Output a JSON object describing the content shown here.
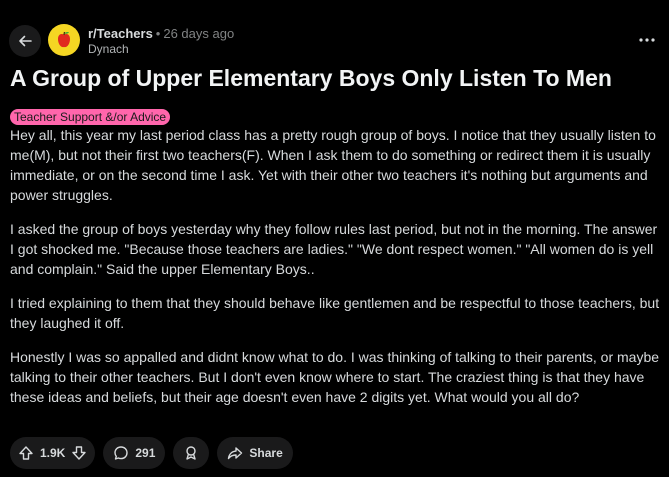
{
  "header": {
    "subreddit": "r/Teachers",
    "separator": "•",
    "time_ago": "26 days ago",
    "author": "Dynach"
  },
  "post": {
    "title": "A Group of Upper Elementary Boys Only Listen To Men",
    "flair": "Teacher Support &/or Advice",
    "paragraphs": [
      "Hey all, this year my last period class has a pretty rough group of boys. I notice that they usually listen to me(M), but not their first two teachers(F). When I ask them to do something or redirect them it is usually immediate, or on the second time I ask. Yet with their other two teachers it's nothing but arguments and power struggles.",
      "I asked the group of boys yesterday why they follow rules last period, but not in the morning. The answer I got shocked me. \"Because those teachers are ladies.\" \"We dont respect women.\" \"All women do is yell and complain.\" Said the upper Elementary Boys..",
      "I tried explaining to them that they should behave like gentlemen and be respectful to those teachers, but they laughed it off.",
      "Honestly I was so appalled and didnt know what to do. I was thinking of talking to their parents, or maybe talking to their other teachers. But I don't even know where to start. The craziest thing is that they have these ideas and beliefs, but their age doesn't even have 2 digits yet. What would you all do?"
    ]
  },
  "actions": {
    "vote_count": "1.9K",
    "comment_count": "291",
    "share_label": "Share"
  },
  "colors": {
    "background": "#000000",
    "flair": "#ff66ac",
    "pill": "#1a1a1b",
    "avatar": "#f5d623"
  }
}
